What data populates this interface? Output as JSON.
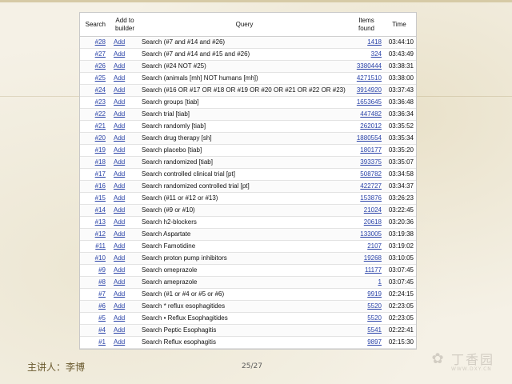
{
  "table": {
    "headers": {
      "search": "Search",
      "add_to_builder": "Add to builder",
      "query": "Query",
      "items_found": "Items found",
      "time": "Time"
    },
    "add_label": "Add",
    "rows": [
      {
        "num": "#28",
        "query": "Search (#7 and #14 and #26)",
        "items": "1418",
        "time": "03:44:10"
      },
      {
        "num": "#27",
        "query": "Search (#7 and #14 and #15 and #26)",
        "items": "324",
        "time": "03:43:49"
      },
      {
        "num": "#26",
        "query": "Search (#24 NOT #25)",
        "items": "3380444",
        "time": "03:38:31"
      },
      {
        "num": "#25",
        "query": "Search (animals [mh] NOT humans [mh])",
        "items": "4271510",
        "time": "03:38:00"
      },
      {
        "num": "#24",
        "query": "Search (#16 OR #17 OR #18 OR #19 OR #20 OR #21 OR #22 OR #23)",
        "items": "3914920",
        "time": "03:37:43"
      },
      {
        "num": "#23",
        "query": "Search groups [tiab]",
        "items": "1653645",
        "time": "03:36:48"
      },
      {
        "num": "#22",
        "query": "Search trial [tiab]",
        "items": "447482",
        "time": "03:36:34"
      },
      {
        "num": "#21",
        "query": "Search randomly [tiab]",
        "items": "262012",
        "time": "03:35:52"
      },
      {
        "num": "#20",
        "query": "Search drug therapy [sh]",
        "items": "1880554",
        "time": "03:35:34"
      },
      {
        "num": "#19",
        "query": "Search placebo [tiab]",
        "items": "180177",
        "time": "03:35:20"
      },
      {
        "num": "#18",
        "query": "Search randomized [tiab]",
        "items": "393375",
        "time": "03:35:07"
      },
      {
        "num": "#17",
        "query": "Search controlled clinical trial [pt]",
        "items": "508782",
        "time": "03:34:58"
      },
      {
        "num": "#16",
        "query": "Search randomized controlled trial [pt]",
        "items": "422727",
        "time": "03:34:37"
      },
      {
        "num": "#15",
        "query": "Search (#11 or #12 or #13)",
        "items": "153876",
        "time": "03:26:23"
      },
      {
        "num": "#14",
        "query": "Search (#9 or #10)",
        "items": "21024",
        "time": "03:22:45"
      },
      {
        "num": "#13",
        "query": "Search h2-blockers",
        "items": "20618",
        "time": "03:20:36"
      },
      {
        "num": "#12",
        "query": "Search Aspartate",
        "items": "133005",
        "time": "03:19:38"
      },
      {
        "num": "#11",
        "query": "Search Famotidine",
        "items": "2107",
        "time": "03:19:02"
      },
      {
        "num": "#10",
        "query": "Search proton pump inhibitors",
        "items": "19268",
        "time": "03:10:05"
      },
      {
        "num": "#9",
        "query": "Search omeprazole",
        "items": "11177",
        "time": "03:07:45"
      },
      {
        "num": "#8",
        "query": "Search ameprazole",
        "items": "1",
        "time": "03:07:45"
      },
      {
        "num": "#7",
        "query": "Search (#1 or #4 or #5 or #6)",
        "items": "9919",
        "time": "02:24:15"
      },
      {
        "num": "#6",
        "query": "Search * reflux esophagitides",
        "items": "5520",
        "time": "02:23:05"
      },
      {
        "num": "#5",
        "query": "Search • Reflux Esophagitides",
        "items": "5520",
        "time": "02:23:05"
      },
      {
        "num": "#4",
        "query": "Search Peptic Esophagitis",
        "items": "5541",
        "time": "02:22:41"
      },
      {
        "num": "#1",
        "query": "Search Reflux esophagitis",
        "items": "9897",
        "time": "02:15:30"
      }
    ]
  },
  "footer": {
    "presenter": "主讲人：李博",
    "page": "25/27"
  },
  "watermark": {
    "brand": "丁香园",
    "url": "WWW.DXY.CN"
  },
  "colors": {
    "link": "#2a43a8",
    "background": "#f5f1e6"
  }
}
